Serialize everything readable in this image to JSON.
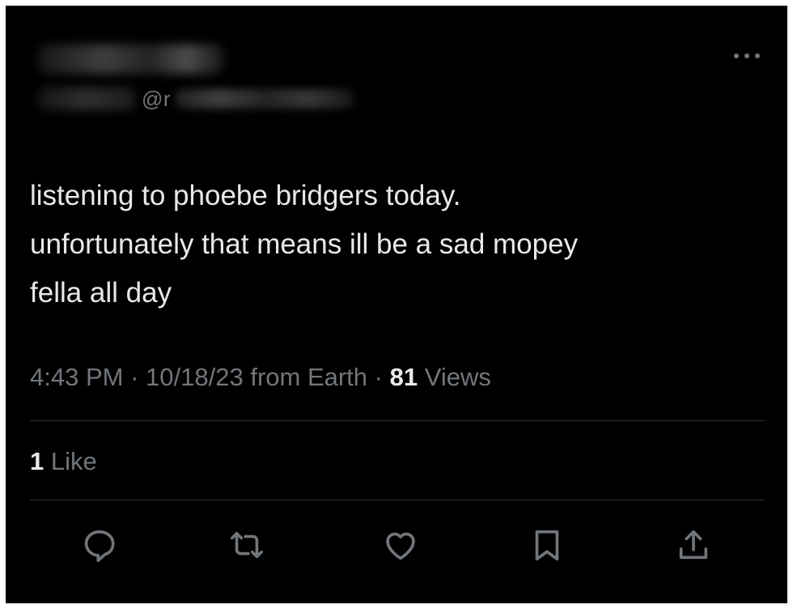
{
  "author": {
    "handle_prefix": "@r"
  },
  "tweet": {
    "text": "listening to phoebe bridgers today.\nunfortunately that means ill be a sad mopey\nfella all day",
    "time": "4:43 PM",
    "date": "10/18/23",
    "source": "from Earth",
    "views_count": "81",
    "views_label": "Views",
    "separator": "·",
    "likes_count": "1",
    "likes_label": "Like"
  },
  "icons": {
    "more": "more-horizontal-icon",
    "reply": "reply-icon",
    "retweet": "retweet-icon",
    "like": "heart-icon",
    "bookmark": "bookmark-icon",
    "share": "share-icon"
  },
  "colors": {
    "background": "#000000",
    "text_primary": "#e7e9ea",
    "text_secondary": "#71767b",
    "divider": "#2f3336"
  }
}
